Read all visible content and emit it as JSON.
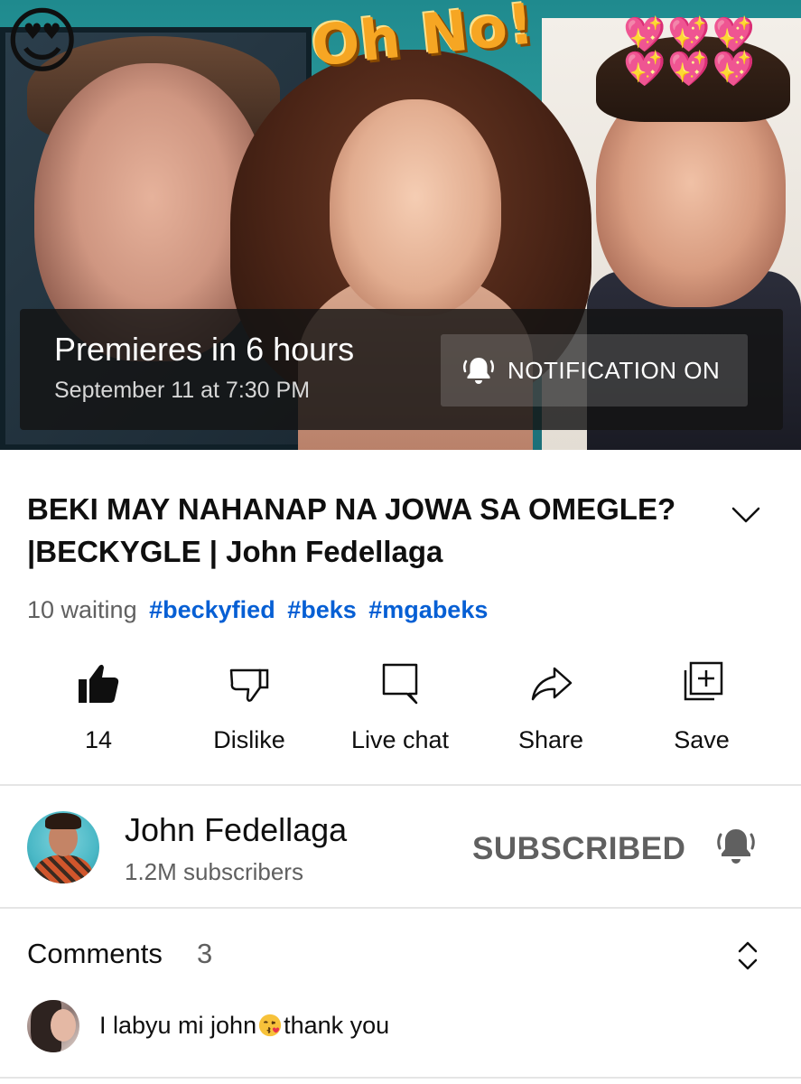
{
  "thumbnail": {
    "overlay_text": "Oh No!",
    "emoji_left": "😍",
    "hearts": [
      "💖",
      "💖",
      "💖",
      "💖",
      "💖",
      "💖"
    ]
  },
  "premiere": {
    "title": "Premieres in 6 hours",
    "date": "September 11 at 7:30 PM",
    "notification_label": "NOTIFICATION ON",
    "notification_icon": "bell-ringing-icon"
  },
  "video": {
    "title": "BEKI MAY NAHANAP NA JOWA SA OMEGLE? |BECKYGLE | John Fedellaga",
    "waiting": "10 waiting",
    "hashtags": [
      "#beckyfied",
      "#beks",
      "#mgabeks"
    ]
  },
  "actions": {
    "like": {
      "label": "14",
      "icon": "thumbs-up-filled-icon"
    },
    "dislike": {
      "label": "Dislike",
      "icon": "thumbs-down-icon"
    },
    "live_chat": {
      "label": "Live chat",
      "icon": "chat-icon"
    },
    "share": {
      "label": "Share",
      "icon": "share-arrow-icon"
    },
    "save": {
      "label": "Save",
      "icon": "add-to-playlist-icon"
    }
  },
  "channel": {
    "name": "John Fedellaga",
    "subscribers": "1.2M subscribers",
    "subscribe_state": "SUBSCRIBED",
    "bell_icon": "bell-filled-icon"
  },
  "comments": {
    "title": "Comments",
    "count": "3",
    "sort_icon": "unfold-icon",
    "first": {
      "text_before": "I labyu mi john",
      "emoji": "😘",
      "text_after": "thank you"
    }
  },
  "colors": {
    "link": "#065fd4",
    "secondary_text": "#606060",
    "primary_text": "#0f0f0f",
    "divider": "#e5e5e5"
  }
}
